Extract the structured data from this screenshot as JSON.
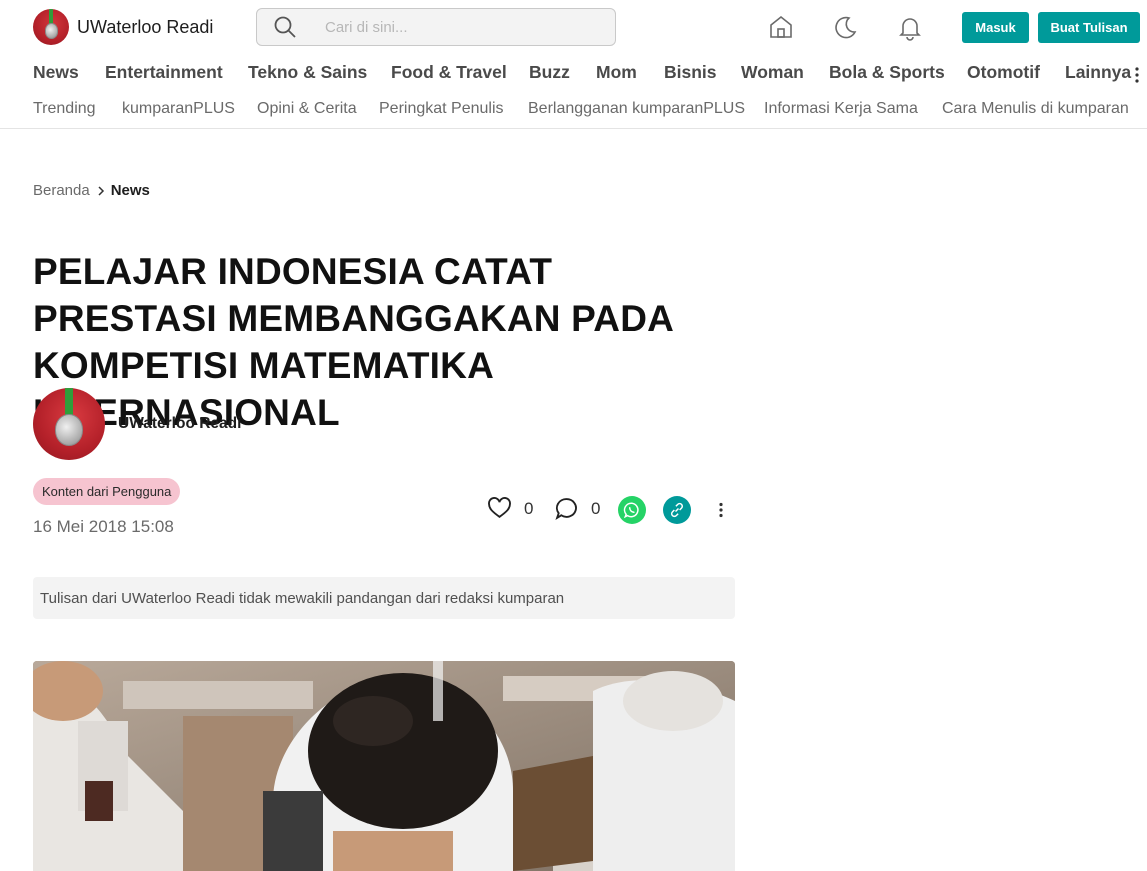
{
  "header": {
    "brand_name": "UWaterloo Readi",
    "search_placeholder": "Cari di sini...",
    "login_label": "Masuk",
    "write_label": "Buat Tulisan",
    "icons": [
      "home-icon",
      "dark-mode-moon-icon",
      "notification-bell-icon",
      "search-icon"
    ]
  },
  "categories": [
    "News",
    "Entertainment",
    "Tekno & Sains",
    "Food & Travel",
    "Buzz",
    "Mom",
    "Bisnis",
    "Woman",
    "Bola & Sports",
    "Otomotif",
    "Lainnya"
  ],
  "subnav": [
    "Trending",
    "kumparanPLUS",
    "Opini & Cerita",
    "Peringkat Penulis",
    "Berlangganan kumparanPLUS",
    "Informasi Kerja Sama",
    "Cara Menulis di kumparan"
  ],
  "breadcrumb": {
    "home": "Beranda",
    "current": "News"
  },
  "article": {
    "title": "PELAJAR INDONESIA CATAT PRESTASI MEMBANGGAKAN PADA KOMPETISI MATEMATIKA INTERNASIONAL",
    "author": "UWaterloo Readi",
    "badge": "Konten dari Pengguna",
    "date": "16 Mei 2018 15:08",
    "likes": "0",
    "comments": "0",
    "disclaimer": "Tulisan dari UWaterloo Readi tidak mewakili pandangan dari redaksi kumparan"
  },
  "colors": {
    "accent": "#009a9a",
    "badge_bg": "#f6c4d0",
    "whatsapp": "#25d366"
  }
}
